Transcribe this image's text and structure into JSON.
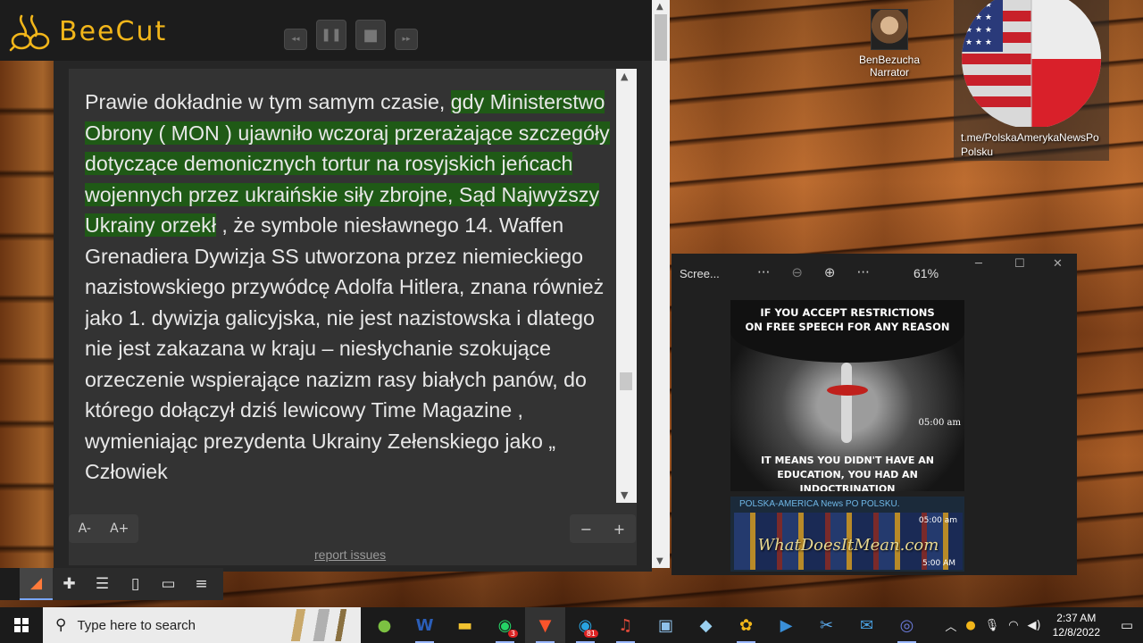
{
  "app": {
    "name": "BeeCut",
    "brand_color": "#f2b61a"
  },
  "reader": {
    "text_before_highlight": "Prawie dokładnie w tym samym czasie, ",
    "highlighted_text": "gdy Ministerstwo Obrony ( MON ) ujawniło wczoraj przerażające szczegóły dotyczące demonicznych tortur na rosyjskich jeńcach wojennych przez ukraińskie siły zbrojne, Sąd Najwyższy Ukrainy orzekł",
    "text_after_highlight": " , że symbole niesławnego 14. Waffen Grenadiera Dywizja SS utworzona przez niemieckiego nazistowskiego przywódcę Adolfa Hitlera, znana również jako 1. dywizja galicyjska, nie jest nazistowska i dlatego nie jest zakazana w kraju – niesłychanie szokujące orzeczenie wspierające nazizm rasy białych panów, do którego dołączył dziś lewicowy Time Magazine , wymieniając prezydenta Ukrainy Zełenskiego jako „ Człowiek",
    "highlight_color": "#1f5a16",
    "font_decrease_label": "A-",
    "font_increase_label": "A+",
    "zoom_out_label": "−",
    "zoom_in_label": "+",
    "report_link": "report issues"
  },
  "media_controls": {
    "rewind": "◂◂",
    "pause": "❚❚",
    "stop": "■",
    "forward": "▸▸"
  },
  "desktop": {
    "narrator_label_line1": "BenBezucha",
    "narrator_label_line2": "Narrator",
    "flag_label_line1": "t.me/PolskaAmerykaNewsPo",
    "flag_label_line2": "Polsku"
  },
  "snip_window": {
    "title": "Scree...",
    "zoom": "61%",
    "meme_top_line1": "IF YOU ACCEPT RESTRICTIONS",
    "meme_top_line2": "ON FREE SPEECH FOR ANY REASON",
    "meme_time": "05:00 am",
    "meme_bottom_line1": "IT MEANS YOU DIDN'T HAVE AN",
    "meme_bottom_line2": "EDUCATION, YOU HAD AN INDOCTRINATION",
    "post_title": "POLSKA-AMERICA News PO POLSKU.",
    "post_watermark": "WhatDoesItMean.com",
    "post_time_top": "05:00 am",
    "post_time_bottom": "5:00 AM"
  },
  "taskbar": {
    "search_placeholder": "Type here to search",
    "whatsapp_badge": "3",
    "telegram_badge": "81",
    "time": "2:37 AM",
    "date": "12/8/2022"
  }
}
